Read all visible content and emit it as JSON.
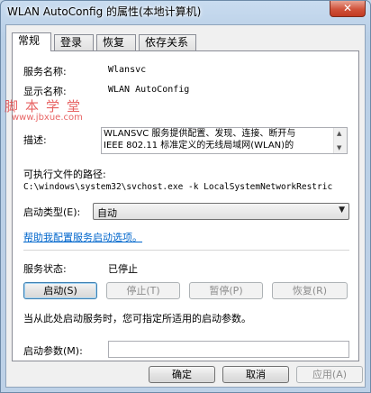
{
  "window": {
    "title": "WLAN AutoConfig 的属性(本地计算机)",
    "close_glyph": "✕"
  },
  "tabs": [
    {
      "label": "常规",
      "active": true
    },
    {
      "label": "登录",
      "active": false
    },
    {
      "label": "恢复",
      "active": false
    },
    {
      "label": "依存关系",
      "active": false
    }
  ],
  "general": {
    "service_name_label": "服务名称:",
    "service_name_value": "Wlansvc",
    "display_name_label": "显示名称:",
    "display_name_value": "WLAN AutoConfig",
    "description_label": "描述:",
    "description_value": "WLANSVC 服务提供配置、发现、连接、断开与\nIEEE 802.11 标准定义的无线局域网(WLAN)的",
    "executable_label": "可执行文件的路径:",
    "executable_value": "C:\\windows\\system32\\svchost.exe -k LocalSystemNetworkRestric",
    "startup_type_label": "启动类型(E):",
    "startup_type_value": "自动",
    "help_link": "帮助我配置服务启动选项。",
    "status_label": "服务状态:",
    "status_value": "已停止",
    "start_button": "启动(S)",
    "stop_button": "停止(T)",
    "pause_button": "暂停(P)",
    "resume_button": "恢复(R)",
    "hint_text": "当从此处启动服务时，您可指定所适用的启动参数。",
    "start_params_label": "启动参数(M):",
    "start_params_value": ""
  },
  "footer": {
    "ok_button": "确定",
    "cancel_button": "取消",
    "apply_button": "应用(A)"
  },
  "watermark": {
    "text": "脚本学堂",
    "url": "www.jbxue.com"
  }
}
